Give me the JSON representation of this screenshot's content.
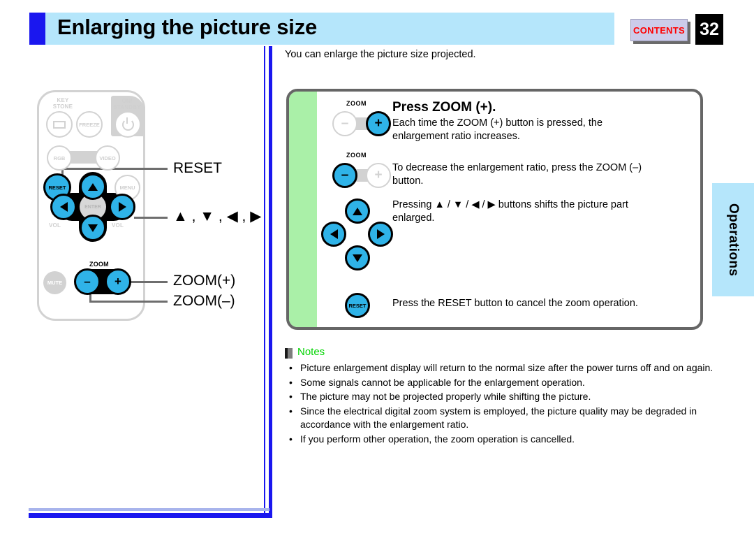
{
  "header": {
    "title": "Enlarging the picture size",
    "contents_label": "CONTENTS",
    "page_number": "32"
  },
  "side_tab": {
    "label": "Operations"
  },
  "remote": {
    "caption_labels": {
      "keystone": "KEY\nSTONE",
      "freeze": "FREEZE",
      "standby": "ON/\nSTANDBY",
      "rgb": "RGB",
      "video": "VIDEO",
      "reset": "RESET",
      "menu": "MENU",
      "enter": "ENTER",
      "vol_minus": "VOL",
      "vol_plus": "VOL",
      "mute": "MUTE",
      "zoom": "ZOOM",
      "zoom_minus": "–",
      "zoom_plus": "+"
    },
    "callouts": [
      {
        "label": "RESET"
      },
      {
        "label": "▲ , ▼ , ◀ , ▶"
      },
      {
        "label": "ZOOM(+)"
      },
      {
        "label": "ZOOM(–)"
      }
    ]
  },
  "main": {
    "intro": "You can enlarge the picture size projected.",
    "panel": {
      "heading": "Press ZOOM (+).",
      "step1_body": "Each time the ZOOM (+) button is pressed, the\nenlargement ratio increases.",
      "step2_body": "To decrease the enlargement ratio, press the ZOOM (–)\nbutton.",
      "step3_body": "Pressing ▲ / ▼ / ◀ / ▶ buttons shifts the picture part\nenlarged.",
      "step4_body": "Press the RESET button to cancel the zoom operation.",
      "zoom_label": "ZOOM",
      "plus_symbol": "+",
      "minus_symbol": "–",
      "reset_label": "RESET"
    }
  },
  "notes": {
    "title": "Notes",
    "bullet": "•",
    "items": [
      "Picture enlargement display will return to the normal size after the power turns off and on again.",
      "Some signals cannot be applicable for the enlargement operation.",
      "The picture may not be projected properly while shifting the picture.",
      "Since the electrical digital zoom system is employed, the picture quality may be degraded in accordance with the enlargement ratio.",
      "If you perform other operation, the zoom operation is cancelled."
    ]
  },
  "colors": {
    "header_bg": "#b5e6fb",
    "accent_blue": "#1a17ef",
    "button_blue": "#2fb3e8",
    "panel_green": "#aaf0a8",
    "notes_green": "#00d400",
    "contents_red": "#ff0000"
  }
}
